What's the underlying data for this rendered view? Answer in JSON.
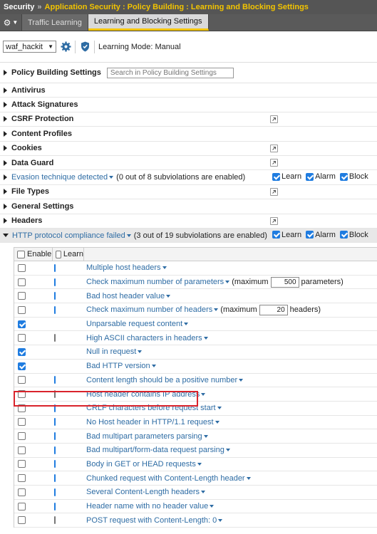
{
  "breadcrumb": {
    "root": "Security",
    "separator": "»",
    "path": "Application Security : Policy Building : Learning and Blocking Settings"
  },
  "tabs": [
    {
      "label": "Traffic Learning",
      "active": false
    },
    {
      "label": "Learning and Blocking Settings",
      "active": true
    }
  ],
  "toolbar": {
    "policy_value": "waf_hackit",
    "learning_mode": "Learning Mode: Manual"
  },
  "policy_building": {
    "title": "Policy Building Settings",
    "search_placeholder": "Search in Policy Building Settings"
  },
  "sections": [
    {
      "name": "Antivirus"
    },
    {
      "name": "Attack Signatures"
    },
    {
      "name": "CSRF Protection",
      "popout": true
    },
    {
      "name": "Content Profiles"
    },
    {
      "name": "Cookies",
      "popout": true
    },
    {
      "name": "Data Guard",
      "popout": true
    },
    {
      "name": "Evasion technique detected",
      "link": true,
      "note": "(0 out of 8 subviolations are enabled)",
      "flags": true
    },
    {
      "name": "File Types",
      "popout": true
    },
    {
      "name": "General Settings"
    },
    {
      "name": "Headers",
      "popout": true
    },
    {
      "name": "HTTP protocol compliance failed",
      "link": true,
      "expanded": true,
      "note": "(3 out of 19 subviolations are enabled)",
      "flags": true
    }
  ],
  "flag_labels": {
    "learn": "Learn",
    "alarm": "Alarm",
    "block": "Block"
  },
  "subtable": {
    "headers": {
      "enable": "Enable",
      "learn": "Learn"
    },
    "rows": [
      {
        "enable": false,
        "learn": true,
        "label": "Multiple host headers"
      },
      {
        "enable": false,
        "learn": true,
        "label": "Check maximum number of parameters",
        "pre": "(maximum",
        "value": "500",
        "post": "parameters)"
      },
      {
        "enable": false,
        "learn": true,
        "label": "Bad host header value"
      },
      {
        "enable": false,
        "learn": true,
        "label": "Check maximum number of headers",
        "pre": "(maximum",
        "value": "20",
        "post": "headers)"
      },
      {
        "enable": true,
        "learn": null,
        "label": "Unparsable request content"
      },
      {
        "enable": false,
        "learn": false,
        "label": "High ASCII characters in headers"
      },
      {
        "enable": true,
        "learn": null,
        "label": "Null in request"
      },
      {
        "enable": true,
        "learn": null,
        "label": "Bad HTTP version"
      },
      {
        "enable": false,
        "learn": true,
        "label": "Content length should be a positive number"
      },
      {
        "enable": false,
        "learn": false,
        "label": "Host header contains IP address",
        "highlighted": true
      },
      {
        "enable": false,
        "learn": true,
        "label": "CRLF characters before request start"
      },
      {
        "enable": false,
        "learn": true,
        "label": "No Host header in HTTP/1.1 request"
      },
      {
        "enable": false,
        "learn": true,
        "label": "Bad multipart parameters parsing"
      },
      {
        "enable": false,
        "learn": true,
        "label": "Bad multipart/form-data request parsing"
      },
      {
        "enable": false,
        "learn": true,
        "label": "Body in GET or HEAD requests"
      },
      {
        "enable": false,
        "learn": true,
        "label": "Chunked request with Content-Length header"
      },
      {
        "enable": false,
        "learn": true,
        "label": "Several Content-Length headers"
      },
      {
        "enable": false,
        "learn": true,
        "label": "Header name with no header value"
      },
      {
        "enable": false,
        "learn": false,
        "label": "POST request with Content-Length: 0"
      }
    ]
  },
  "colors": {
    "accent": "#f3c400",
    "link": "#2e6ca4",
    "checkbox": "#1f7ce0",
    "highlight": "#d9232b"
  }
}
